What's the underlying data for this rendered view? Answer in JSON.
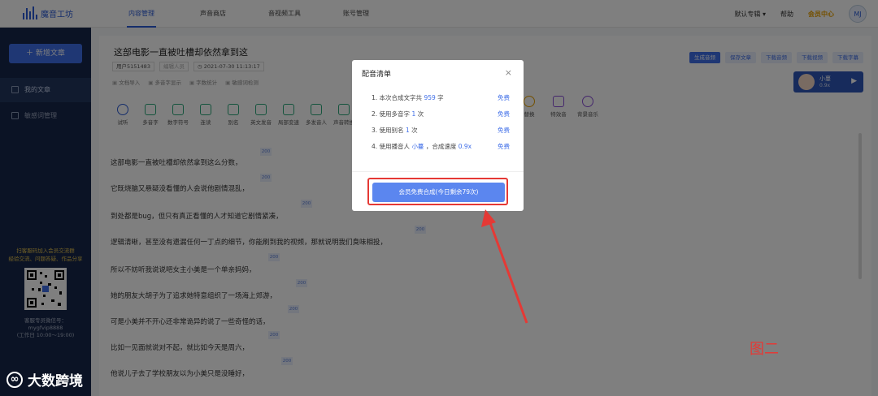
{
  "app": {
    "name": "魔音工坊"
  },
  "nav": {
    "tabs": [
      {
        "label": "内容管理"
      },
      {
        "label": "声音商店"
      },
      {
        "label": "音视频工具"
      },
      {
        "label": "账号管理"
      }
    ]
  },
  "top_right": {
    "album": "默认专辑",
    "help": "帮助",
    "vip": "会员中心",
    "avatar_text": "MJ"
  },
  "sidebar": {
    "new_button": "新增文章",
    "items": [
      {
        "label": "我的文章"
      },
      {
        "label": "敏感词管理"
      }
    ],
    "promo": [
      "扫客服码加入会员交流群",
      "经验交流、问题答疑、作品分享"
    ],
    "wechat": [
      "客服专员微信号：",
      "mygfvip8888",
      "(工作日 10:00～19:00)"
    ]
  },
  "watermark": "大数跨境",
  "doc": {
    "title": "这部电影一直被吐槽却依然拿到这",
    "user": "用户5151483",
    "author_placeholder": "编辑人员",
    "date": "2021-07-30 11:13:17",
    "tools_row": [
      "文档导入",
      "多音字显示",
      "字数统计",
      "敏感词检测"
    ]
  },
  "actions": [
    "生成音频",
    "保存文章",
    "下载音频",
    "下载视频",
    "下载字幕"
  ],
  "voice": {
    "name": "小蔓",
    "speed": "0.9x"
  },
  "toolbar": [
    "试听",
    "多音字",
    "数字符号",
    "连读",
    "别名",
    "英文发音",
    "局部变速",
    "多发音人",
    "声音转换"
  ],
  "toolbar_right": [
    "替换",
    "特效音",
    "背景音乐"
  ],
  "text_lines": [
    {
      "text": "这部电影一直被吐槽却依然拿到这么分数，",
      "tag": "200"
    },
    {
      "text": "它既烧脑又悬疑没看懂的人会说他剧情混乱，",
      "tag": "200"
    },
    {
      "text": "到处都是bug，但只有真正看懂的人才知道它剧情紧凑，",
      "tag": "200"
    },
    {
      "text": "逻辑清晰，甚至没有遗漏任何一丁点的细节，你能刷到我的视频，那就说明我们臭味相投，",
      "tag": "200"
    },
    {
      "text": "所以不妨听我说说吧女主小美是一个单亲妈妈，",
      "tag": "200"
    },
    {
      "text": "她的朋友大胡子为了追求她特意组织了一场海上郊游，",
      "tag": "200"
    },
    {
      "text": "可是小美并不开心还非常诡异的说了一些奇怪的话，",
      "tag": "200"
    },
    {
      "text": "比如一见面就说对不起，就比如今天是周六，",
      "tag": "200"
    },
    {
      "text": "他说儿子去了学校朋友以为小美只是没睡好，",
      "tag": "200"
    }
  ],
  "modal": {
    "title": "配音清单",
    "close": "×",
    "rows": [
      {
        "prefix": "1. 本次合成文字共 ",
        "value": "959",
        "suffix": " 字",
        "price": "免费"
      },
      {
        "prefix": "2. 使用多音字 ",
        "value": "1",
        "suffix": " 次",
        "price": "免费"
      },
      {
        "prefix": "3. 使用别名 ",
        "value": "1",
        "suffix": " 次",
        "price": "免费"
      },
      {
        "prefix": "4. 使用播音人 ",
        "value": "小蔓",
        "suffix": " ，合成速度 ",
        "value2": "0.9x",
        "price": "免费"
      }
    ],
    "submit": "会员免费合成(今日剩余79次)"
  },
  "caption": "图二",
  "colors": {
    "accent": "#3f6ee8",
    "sidebar": "#16264a",
    "highlight": "#e53935",
    "vip": "#e8a100"
  }
}
